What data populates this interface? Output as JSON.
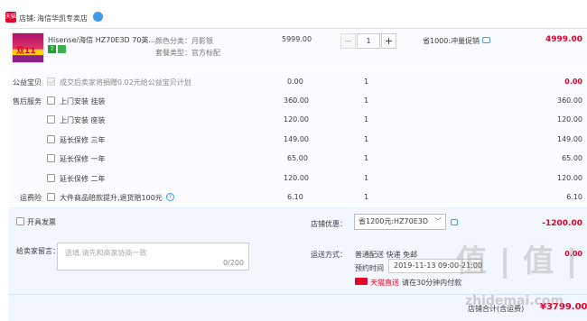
{
  "shop": {
    "label": "店铺:",
    "name": "海信华凯专卖店",
    "tmall_badge": "天猫"
  },
  "product": {
    "title": "Hisense/海信 HZ70E3D 70英...",
    "thumb_text": "双11",
    "attr_color": "颜色分类：月影银",
    "attr_package": "套餐类型：官方标配",
    "price": "5999.00",
    "qty": "1",
    "promo": "省1000:冲量促销",
    "subtotal": "4999.00"
  },
  "addons": [
    {
      "section": "公益宝贝",
      "label": "成交后卖家将捐赠0.02元给公益宝贝计划",
      "price": "0.00",
      "qty": "1",
      "total": "0.00",
      "disabled": true,
      "help": false
    },
    {
      "section": "售后服务",
      "label": "上门安装 挂装",
      "price": "360.00",
      "qty": "1",
      "total": "360.00",
      "disabled": false,
      "help": false
    },
    {
      "section": "",
      "label": "上门安装 座装",
      "price": "120.00",
      "qty": "1",
      "total": "120.00",
      "disabled": false,
      "help": false
    },
    {
      "section": "",
      "label": "延长保修 三年",
      "price": "149.00",
      "qty": "1",
      "total": "149.00",
      "disabled": false,
      "help": false
    },
    {
      "section": "",
      "label": "延长保修 一年",
      "price": "65.00",
      "qty": "1",
      "total": "65.00",
      "disabled": false,
      "help": false
    },
    {
      "section": "",
      "label": "延长保修 二年",
      "price": "120.00",
      "qty": "1",
      "total": "120.00",
      "disabled": false,
      "help": false
    },
    {
      "section": "运费险",
      "label": "大件商品赔款提升,退货赔100元",
      "price": "6.10",
      "qty": "1",
      "total": "6.10",
      "disabled": false,
      "help": true
    }
  ],
  "invoice": {
    "label": "开具发票"
  },
  "shop_discount": {
    "label": "店铺优惠：",
    "value": "省1200元:HZ70E3D",
    "amount": "-1200.00"
  },
  "message": {
    "label": "给卖家留言：",
    "placeholder": "选填,请先和商家协商一致",
    "count": "0/200"
  },
  "shipping": {
    "label": "运送方式：",
    "method": "普通配送 快递 免邮",
    "fee": "0.00",
    "time_label": "预约时间",
    "time_value": "2019-11-13 09:00-21:00",
    "tmall_direct": "天猫直送",
    "pay_note": "请在30分钟内付款"
  },
  "footer": {
    "total_label": "店铺合计(含运费)",
    "total": "¥3799.00"
  },
  "watermark": {
    "brand": "值 | 值 | 值",
    "site": "zhidemai.com"
  },
  "colors": {
    "accent_red": "#e4002b",
    "link_blue": "#3d9be8"
  }
}
